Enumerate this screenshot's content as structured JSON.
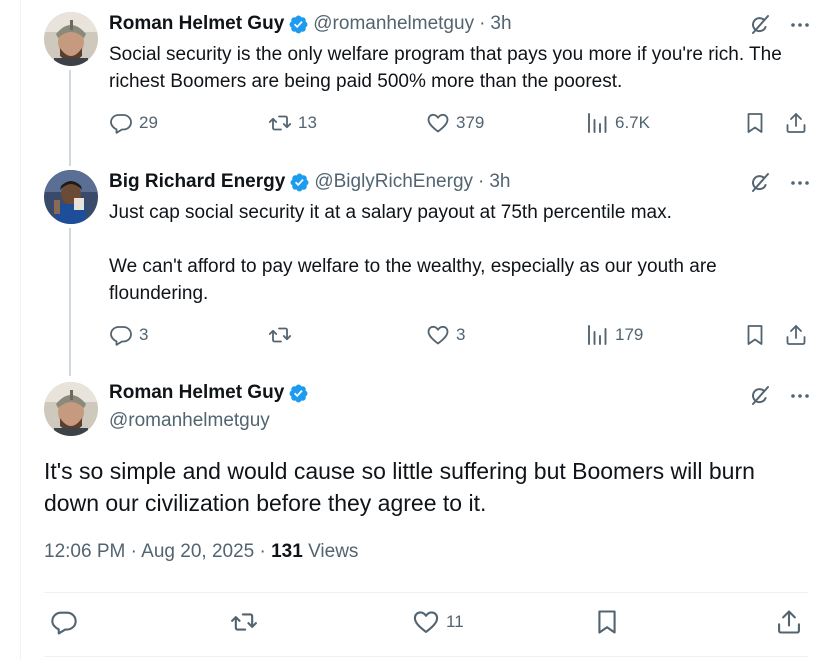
{
  "colors": {
    "accent": "#1d9bf0",
    "text": "#0f1419",
    "muted": "#536471",
    "line": "#cfd9de"
  },
  "tweets": [
    {
      "name": "Roman Helmet Guy",
      "handle": "@romanhelmetguy",
      "time": "3h",
      "paragraphs": [
        "Social security is the only welfare program that pays you more if you're rich. The richest Boomers are being paid 500% more than the poorest."
      ],
      "replies": "29",
      "reposts": "13",
      "likes": "379",
      "views": "6.7K"
    },
    {
      "name": "Big Richard Energy",
      "handle": "@BiglyRichEnergy",
      "time": "3h",
      "paragraphs": [
        "Just cap social security it at a salary payout at 75th percentile max.",
        "We can't afford to pay welfare to the wealthy, especially as our youth are floundering."
      ],
      "replies": "3",
      "reposts": "",
      "likes": "3",
      "views": "179"
    }
  ],
  "main": {
    "name": "Roman Helmet Guy",
    "handle": "@romanhelmetguy",
    "text": "It's so simple and would cause so little suffering but Boomers will burn down our civilization before they agree to it.",
    "time": "12:06 PM",
    "date": "Aug 20, 2025",
    "views_count": "131",
    "views_label": "Views",
    "likes": "11"
  },
  "icons": [
    "verified-badge-icon",
    "grok-icon",
    "more-icon",
    "reply-icon",
    "repost-icon",
    "like-icon",
    "views-icon",
    "bookmark-icon",
    "share-icon"
  ]
}
